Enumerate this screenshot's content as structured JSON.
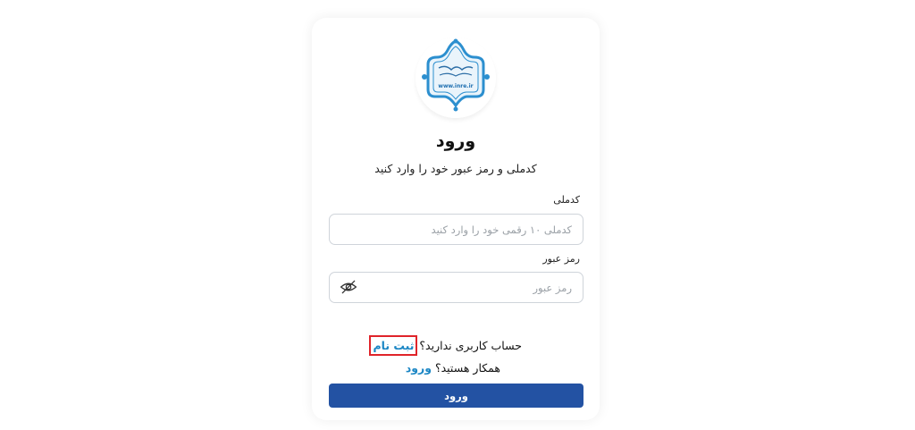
{
  "logo": {
    "site_text": "www.inre.ir",
    "brand_color": "#1e6fb0"
  },
  "login": {
    "title": "ورود",
    "subtitle": "کدملی و رمز عبور خود را وارد کنید"
  },
  "fields": {
    "national_code": {
      "label": "کدملی",
      "placeholder": "کدملی ۱۰ رقمی خود را وارد کنید",
      "value": ""
    },
    "password": {
      "label": "رمز عبور",
      "placeholder": "رمز عبور",
      "value": ""
    }
  },
  "links": {
    "no_account_text": "حساب کاربری ندارید؟",
    "register_label": "ثبت نام",
    "partner_text": "همکار هستید؟",
    "partner_login_label": "ورود"
  },
  "submit": {
    "label": "ورود",
    "color": "#2352a3"
  },
  "annotation": {
    "highlight_color": "#e0242a",
    "arrow_color": "#e8232a"
  },
  "icons": {
    "password_toggle": "eye-slash-icon",
    "pointer_arrow": "arrow-right-icon"
  }
}
